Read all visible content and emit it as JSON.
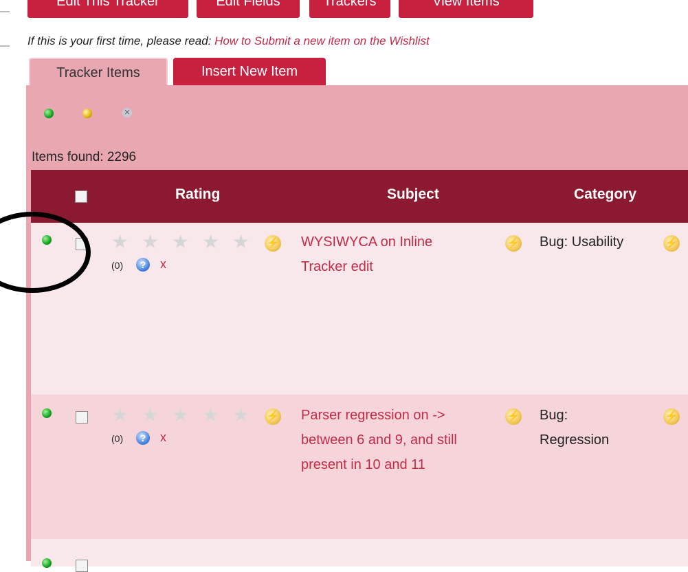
{
  "toolbar": {
    "buttons": [
      "Edit This Tracker",
      "Edit Fields",
      "Trackers",
      "View Items"
    ]
  },
  "intro": {
    "text": "If this is your first time, please read:",
    "link": "How to Submit a new item on the Wishlist"
  },
  "tabs": [
    "Tracker Items",
    "Insert New Item"
  ],
  "items_found": "Items found: 2296",
  "table": {
    "headers": [
      "Rating",
      "Subject",
      "Category"
    ],
    "rows": [
      {
        "status": "green",
        "count": "(0)",
        "delete": "x",
        "subject_lines": [
          "WYSIWYCA on Inline",
          "Tracker edit"
        ],
        "category_lines": [
          "Bug: Usability"
        ]
      },
      {
        "status": "green",
        "count": "(0)",
        "delete": "x",
        "subject_lines": [
          "Parser regression on ->",
          "between 6 and 9, and still",
          "present in 10 and 11"
        ],
        "category_lines": [
          "Bug:",
          "Regression"
        ]
      }
    ]
  },
  "icons": {
    "status_filters": [
      "green-dot-icon",
      "yellow-dot-icon",
      "gray-x-icon"
    ],
    "star": "star-icon",
    "help": "help-icon",
    "edit": "lightning-edit-icon"
  },
  "colors": {
    "accent": "#c8203f",
    "header": "#8b1a30",
    "panel": "#e9a7b2",
    "link": "#c22a48"
  }
}
